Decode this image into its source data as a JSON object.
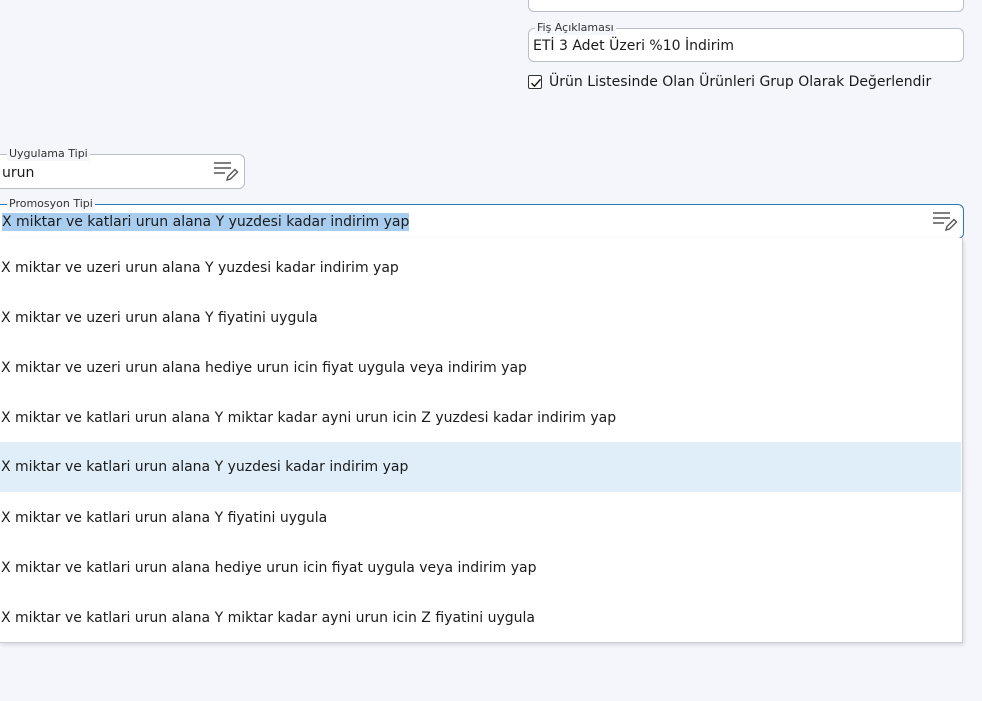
{
  "fis_aciklamasi": {
    "label": "Fiş Açıklaması",
    "value": "ETİ 3 Adet Üzeri %10 İndirim"
  },
  "group_checkbox": {
    "checked": true,
    "label": "Ürün Listesinde Olan Ürünleri Grup Olarak Değerlendir"
  },
  "uygulama_tipi": {
    "label": "Uygulama Tipi",
    "value": "urun",
    "icon": "list-edit-icon"
  },
  "promosyon_tipi": {
    "label": "Promosyon Tipi",
    "value": "X miktar ve katlari urun alana Y yuzdesi kadar indirim yap",
    "icon": "list-edit-icon"
  },
  "dropdown": {
    "options": [
      "X miktar ve uzeri urun alana Y yuzdesi kadar indirim yap",
      "X miktar ve uzeri urun alana Y fiyatini uygula",
      "X miktar ve uzeri urun alana hediye urun icin fiyat uygula veya indirim yap",
      "X miktar ve katlari urun alana Y miktar kadar ayni urun icin Z yuzdesi kadar indirim yap",
      "X miktar ve katlari urun alana Y yuzdesi kadar indirim yap",
      "X miktar ve katlari urun alana Y fiyatini uygula",
      "X miktar ve katlari urun alana hediye urun icin fiyat uygula veya indirim yap",
      "X miktar ve katlari urun alana Y miktar kadar ayni urun icin Z fiyatini uygula"
    ],
    "highlighted_index": 4
  },
  "colors": {
    "background": "#f4f6fb",
    "focus_border": "#2a7ab8",
    "highlight": "#dfeef8",
    "selection": "#a8cdef"
  }
}
